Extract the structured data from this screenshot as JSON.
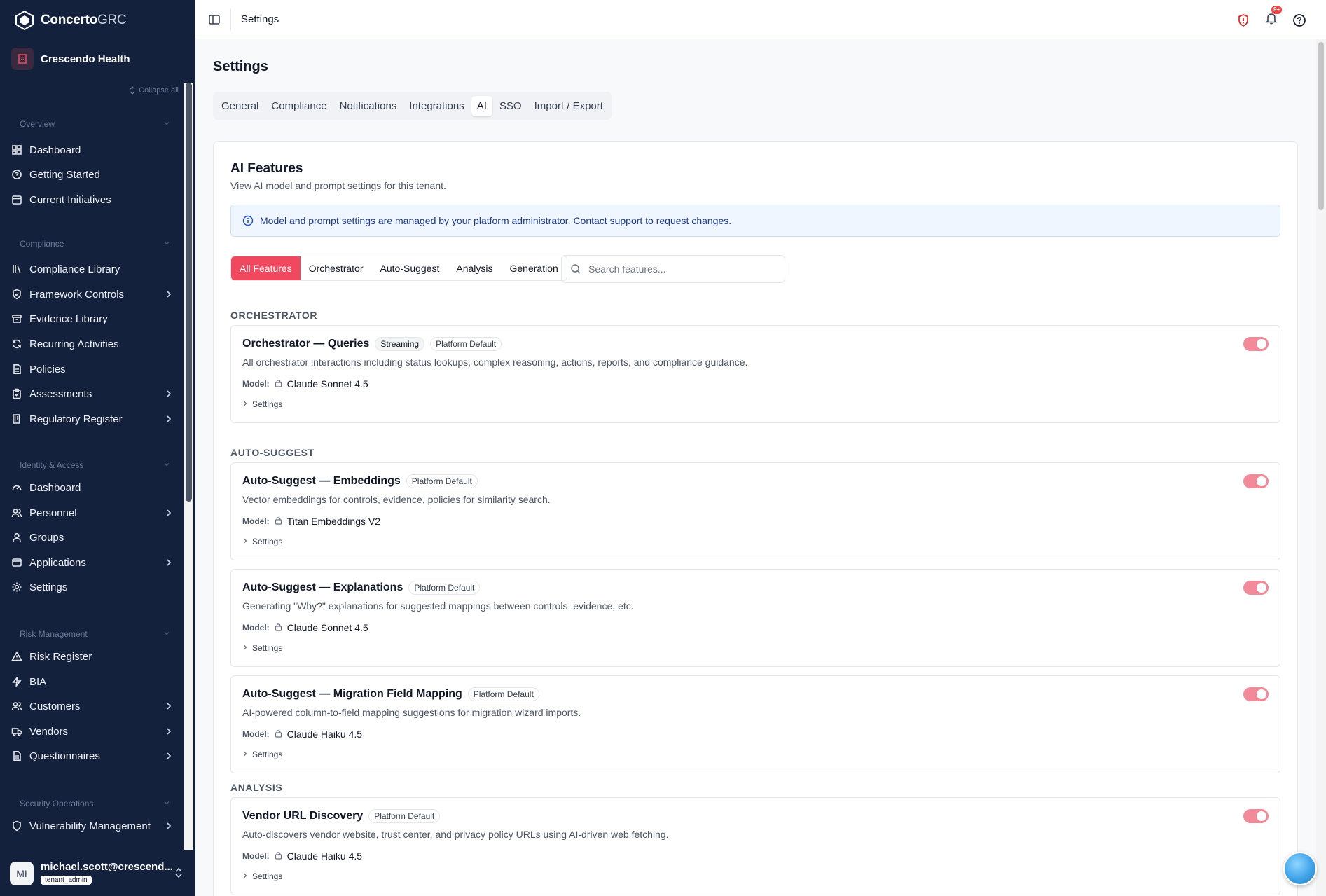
{
  "app": {
    "brand_bold": "Concerto",
    "brand_light": "GRC",
    "org_name": "Crescendo Health",
    "collapse_all": "Collapse all"
  },
  "sidebar": {
    "sections": [
      {
        "title": "Overview",
        "items": [
          {
            "label": "Dashboard",
            "icon": "dashboard-icon",
            "chevron": false
          },
          {
            "label": "Getting Started",
            "icon": "help-circle-icon",
            "chevron": false
          },
          {
            "label": "Current Initiatives",
            "icon": "calendar-icon",
            "chevron": false
          }
        ]
      },
      {
        "title": "Compliance",
        "items": [
          {
            "label": "Compliance Library",
            "icon": "library-icon",
            "chevron": false
          },
          {
            "label": "Framework Controls",
            "icon": "shield-check-icon",
            "chevron": true
          },
          {
            "label": "Evidence Library",
            "icon": "archive-icon",
            "chevron": false
          },
          {
            "label": "Recurring Activities",
            "icon": "refresh-icon",
            "chevron": false
          },
          {
            "label": "Policies",
            "icon": "file-text-icon",
            "chevron": false
          },
          {
            "label": "Assessments",
            "icon": "clipboard-check-icon",
            "chevron": true
          },
          {
            "label": "Regulatory Register",
            "icon": "book-icon",
            "chevron": true
          }
        ]
      },
      {
        "title": "Identity & Access",
        "items": [
          {
            "label": "Dashboard",
            "icon": "gauge-icon",
            "chevron": false
          },
          {
            "label": "Personnel",
            "icon": "users-icon",
            "chevron": true
          },
          {
            "label": "Groups",
            "icon": "user-group-icon",
            "chevron": false
          },
          {
            "label": "Applications",
            "icon": "app-window-icon",
            "chevron": true
          },
          {
            "label": "Settings",
            "icon": "gear-icon",
            "chevron": false
          }
        ]
      },
      {
        "title": "Risk Management",
        "items": [
          {
            "label": "Risk Register",
            "icon": "alert-triangle-icon",
            "chevron": false
          },
          {
            "label": "BIA",
            "icon": "zap-icon",
            "chevron": false
          },
          {
            "label": "Customers",
            "icon": "users-icon",
            "chevron": true
          },
          {
            "label": "Vendors",
            "icon": "truck-icon",
            "chevron": true
          },
          {
            "label": "Questionnaires",
            "icon": "file-text-icon",
            "chevron": true
          }
        ]
      },
      {
        "title": "Security Operations",
        "items": [
          {
            "label": "Vulnerability Management",
            "icon": "shield-icon",
            "chevron": true
          }
        ]
      }
    ]
  },
  "user": {
    "initials": "MI",
    "email": "michael.scott@crescend...",
    "role": "tenant_admin"
  },
  "topbar": {
    "title": "Settings",
    "notif_count": "9+"
  },
  "page": {
    "title": "Settings",
    "tabs": [
      "General",
      "Compliance",
      "Notifications",
      "Integrations",
      "AI",
      "SSO",
      "Import / Export"
    ],
    "active_tab": "AI"
  },
  "ai": {
    "title": "AI Features",
    "subtitle": "View AI model and prompt settings for this tenant.",
    "info": "Model and prompt settings are managed by your platform administrator. Contact support to request changes.",
    "filters": [
      "All Features",
      "Orchestrator",
      "Auto-Suggest",
      "Analysis",
      "Generation"
    ],
    "active_filter": "All Features",
    "search_placeholder": "Search features...",
    "model_label": "Model:",
    "settings_label": "Settings",
    "groups": [
      {
        "label": "ORCHESTRATOR",
        "features": [
          {
            "name": "Orchestrator — Queries",
            "badges": [
              "Streaming",
              "Platform Default"
            ],
            "desc": "All orchestrator interactions including status lookups, complex reasoning, actions, reports, and compliance guidance.",
            "model": "Claude Sonnet 4.5",
            "enabled": true
          }
        ]
      },
      {
        "label": "AUTO-SUGGEST",
        "features": [
          {
            "name": "Auto-Suggest — Embeddings",
            "badges": [
              "Platform Default"
            ],
            "desc": "Vector embeddings for controls, evidence, policies for similarity search.",
            "model": "Titan Embeddings V2",
            "enabled": true
          },
          {
            "name": "Auto-Suggest — Explanations",
            "badges": [
              "Platform Default"
            ],
            "desc": "Generating \"Why?\" explanations for suggested mappings between controls, evidence, etc.",
            "model": "Claude Sonnet 4.5",
            "enabled": true
          },
          {
            "name": "Auto-Suggest — Migration Field Mapping",
            "badges": [
              "Platform Default"
            ],
            "desc": "AI-powered column-to-field mapping suggestions for migration wizard imports.",
            "model": "Claude Haiku 4.5",
            "enabled": true
          }
        ]
      },
      {
        "label": "ANALYSIS",
        "features": [
          {
            "name": "Vendor URL Discovery",
            "badges": [
              "Platform Default"
            ],
            "desc": "Auto-discovers vendor website, trust center, and privacy policy URLs using AI-driven web fetching.",
            "model": "Claude Haiku 4.5",
            "enabled": true
          }
        ]
      }
    ]
  },
  "colors": {
    "sidebar_bg": "#14213d",
    "accent": "#f0485f",
    "toggle_on": "#f28a9a",
    "info_bg": "#eff6ff"
  }
}
